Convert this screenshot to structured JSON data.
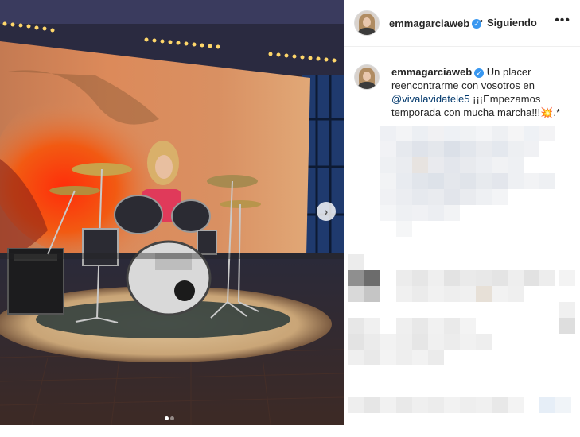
{
  "post": {
    "username": "emmagarciaweb",
    "verified_icon": "verified-badge-icon",
    "separator": "•",
    "follow_status": "Siguiendo",
    "options_icon": "more-options-icon"
  },
  "caption": {
    "username": "emmagarciaweb",
    "text_before": "Un placer reencontrarme con vosotros en",
    "mention": "@vivalavidatele5",
    "text_after": "¡¡¡Empezamos temporada con mucha marcha!!!",
    "emoji": "💥",
    "trailing": ".*"
  },
  "carousel": {
    "next_icon": "chevron-right-icon",
    "pages_total": 2,
    "current_page": 1
  },
  "colors": {
    "accent_blue": "#3897f0",
    "mention_blue": "#00376b",
    "text": "#262626"
  }
}
